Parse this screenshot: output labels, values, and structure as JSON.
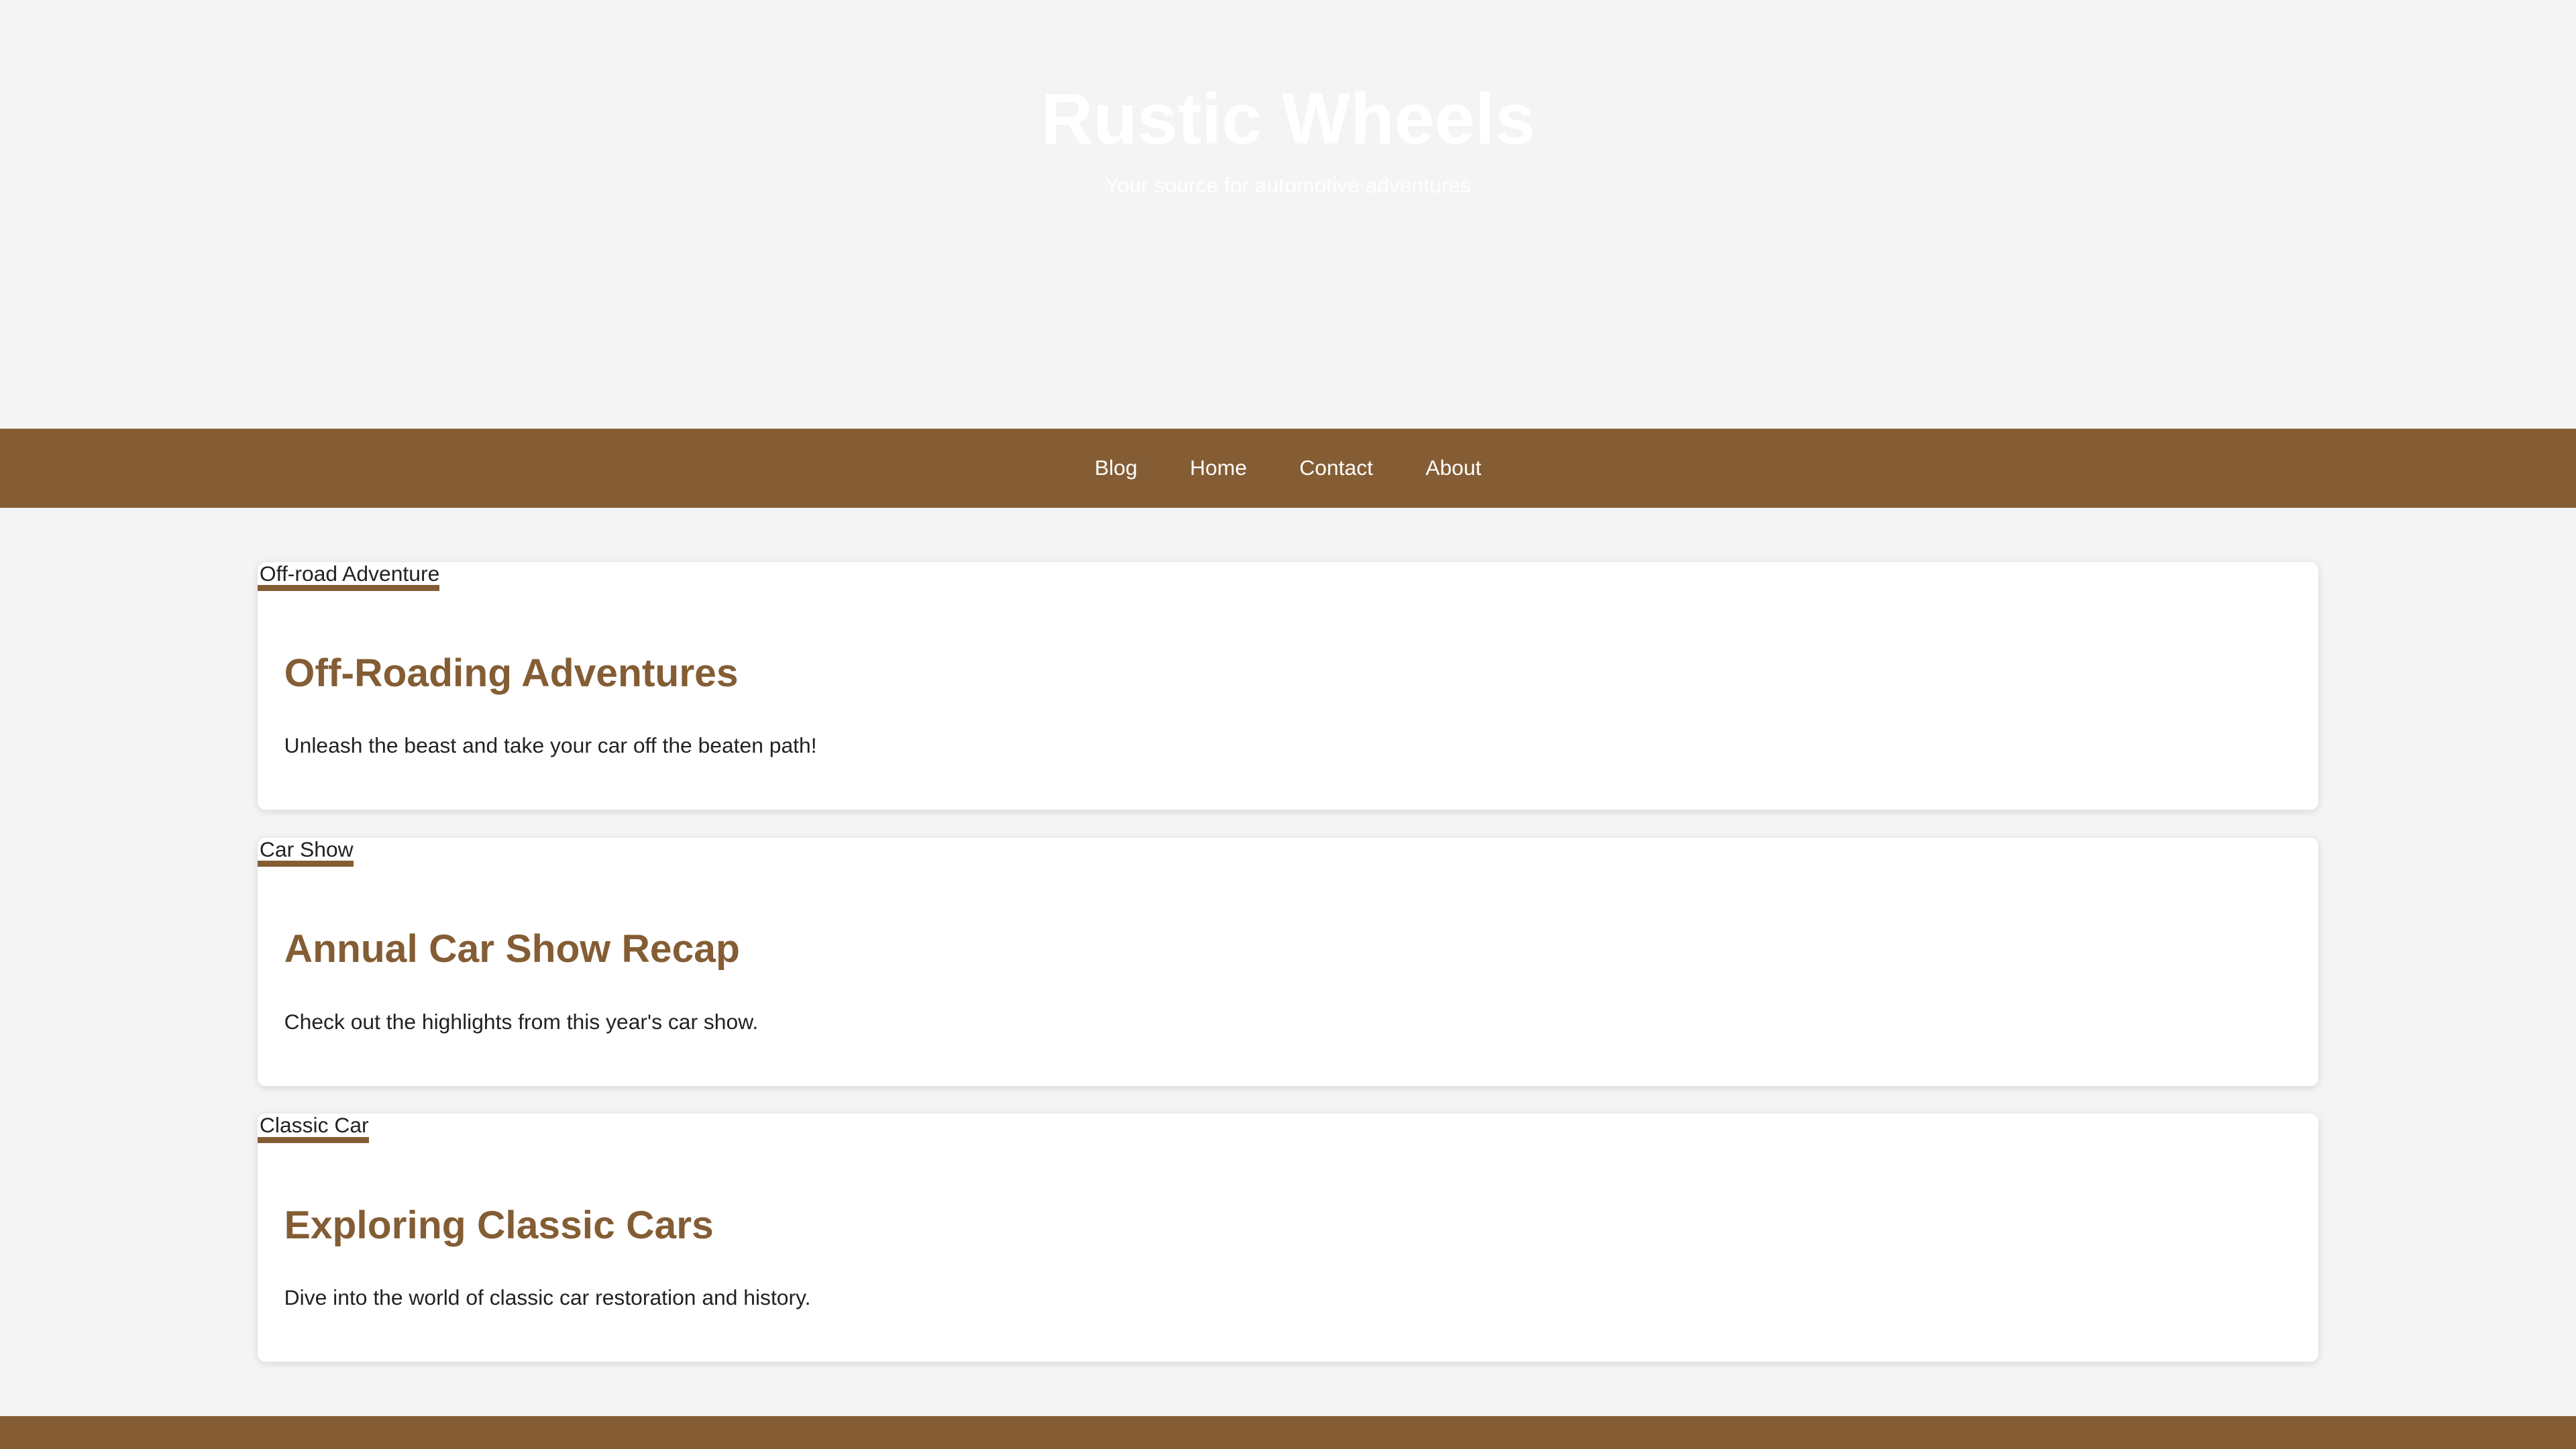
{
  "header": {
    "title": "Rustic Wheels",
    "subtitle": "Your source for automotive adventures"
  },
  "nav": {
    "items": [
      {
        "label": "Blog"
      },
      {
        "label": "Home"
      },
      {
        "label": "Contact"
      },
      {
        "label": "About"
      }
    ]
  },
  "posts": [
    {
      "image_alt": "Off-road Adventure",
      "title": "Off-Roading Adventures",
      "excerpt": "Unleash the beast and take your car off the beaten path!"
    },
    {
      "image_alt": "Car Show",
      "title": "Annual Car Show Recap",
      "excerpt": "Check out the highlights from this year's car show."
    },
    {
      "image_alt": "Classic Car",
      "title": "Exploring Classic Cars",
      "excerpt": "Dive into the world of classic car restoration and history."
    }
  ],
  "colors": {
    "accent": "#845d34",
    "background": "#f4f4f4",
    "card": "#ffffff",
    "text": "#222222"
  },
  "icons": {
    "post_image": "broken-image-icon"
  }
}
